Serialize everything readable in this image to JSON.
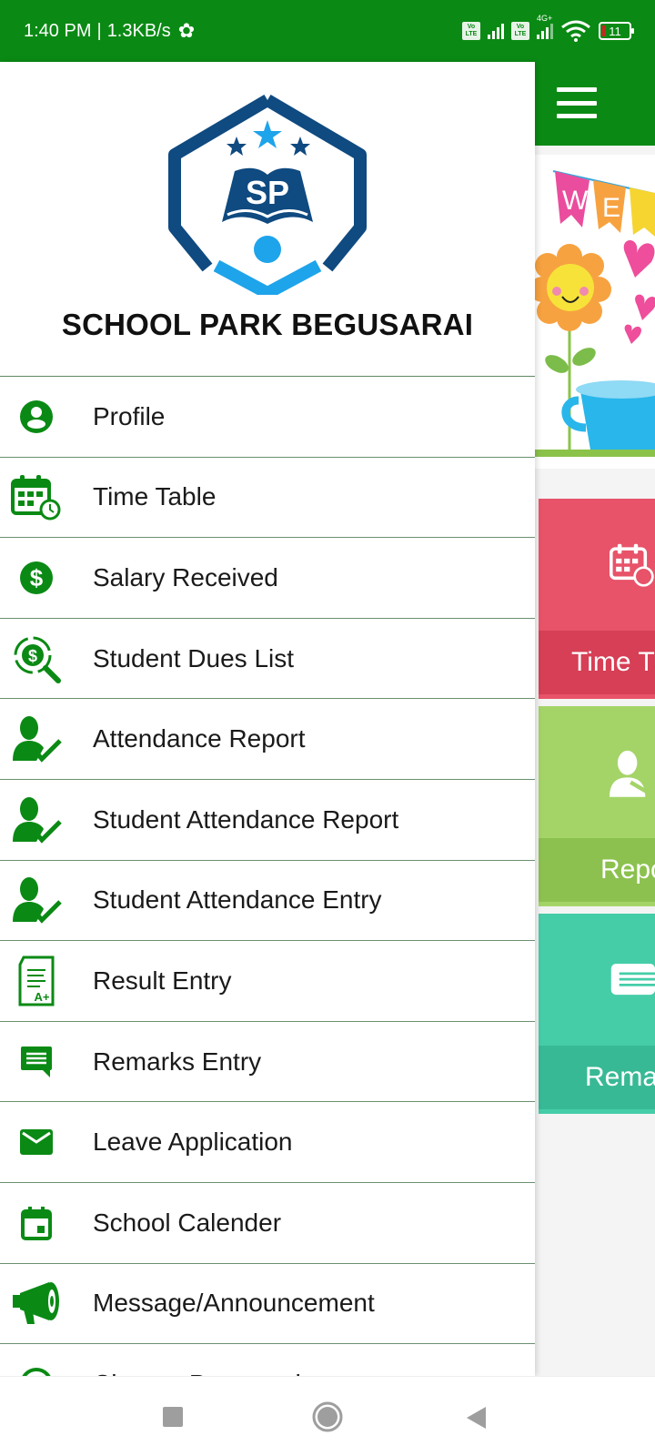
{
  "status_bar": {
    "time": "1:40 PM",
    "separator": "|",
    "net_speed": "1.3KB/s",
    "volte_label": "Vo LTE",
    "network_type": "4G+",
    "battery_level": "11",
    "icons": [
      "settings-gear-icon",
      "volte-icon",
      "signal-icon",
      "volte-icon",
      "signal-4g-icon",
      "wifi-icon",
      "battery-icon"
    ]
  },
  "drawer": {
    "school_name": "SCHOOL PARK BEGUSARAI",
    "logo_text": "SP",
    "menu_items": [
      {
        "label": "Profile",
        "icon": "account-circle-icon"
      },
      {
        "label": "Time Table",
        "icon": "calendar-clock-icon"
      },
      {
        "label": "Salary Received",
        "icon": "dollar-circle-icon"
      },
      {
        "label": "Student Dues List",
        "icon": "dollar-search-icon"
      },
      {
        "label": "Attendance Report",
        "icon": "user-check-icon"
      },
      {
        "label": "Student Attendance Report",
        "icon": "user-check-icon"
      },
      {
        "label": "Student Attendance Entry",
        "icon": "user-check-icon"
      },
      {
        "label": "Result Entry",
        "icon": "grade-sheet-icon"
      },
      {
        "label": "Remarks Entry",
        "icon": "comment-icon"
      },
      {
        "label": "Leave Application",
        "icon": "mail-icon"
      },
      {
        "label": "School Calender",
        "icon": "calendar-event-icon"
      },
      {
        "label": "Message/Announcement",
        "icon": "megaphone-icon"
      },
      {
        "label": "Change Password",
        "icon": "lock-circle-icon"
      }
    ]
  },
  "main": {
    "banner_text": "WEL",
    "tiles": [
      {
        "label": "Time T",
        "color": "#e8536a",
        "icon": "calendar-clock-icon"
      },
      {
        "label": "Repo",
        "color": "#a4d468",
        "icon": "user-report-icon"
      },
      {
        "label": "Rema",
        "color": "#45cda8",
        "icon": "comment-icon"
      }
    ]
  },
  "colors": {
    "primary": "#0a8a14",
    "logo_dark": "#0f4a80",
    "logo_light": "#1ea4ea"
  }
}
